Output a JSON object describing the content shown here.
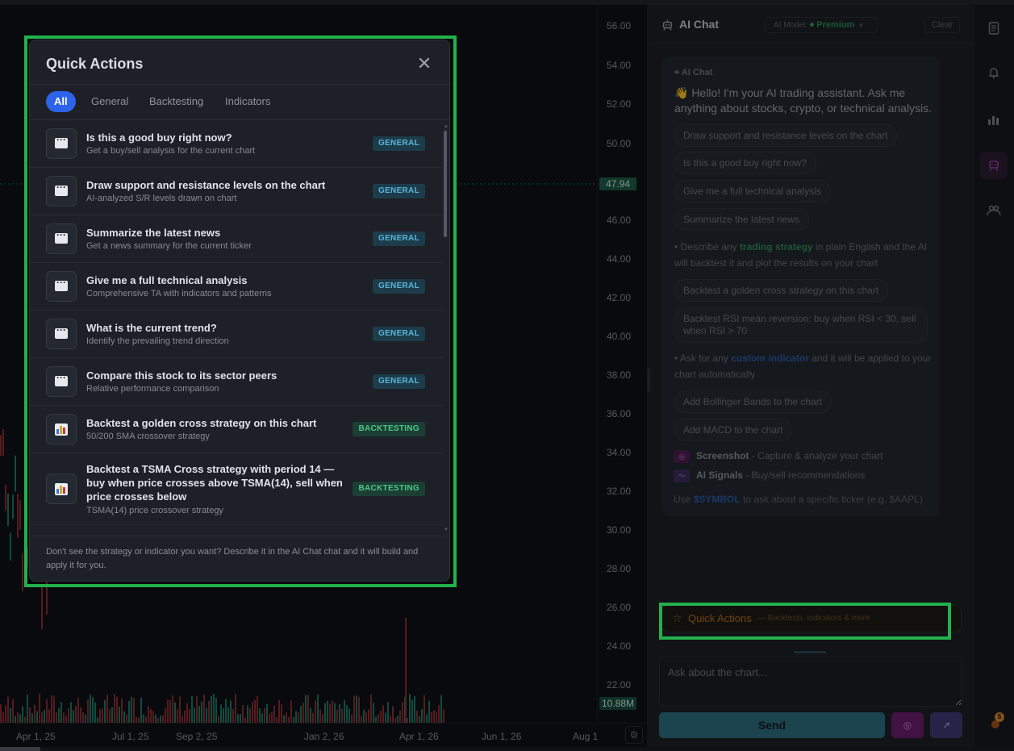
{
  "chart": {
    "price_ticks": [
      "56.00",
      "54.00",
      "52.00",
      "50.00",
      "46.00",
      "44.00",
      "42.00",
      "40.00",
      "38.00",
      "36.00",
      "34.00",
      "32.00",
      "30.00",
      "28.00",
      "26.00",
      "24.00",
      "22.00"
    ],
    "last_price": "47.94",
    "volume_tag": "10.88M",
    "time_ticks": [
      "Apr 1, 25",
      "Jul 1, 25",
      "Sep 2, 25",
      "Jan 2, 26",
      "Apr 1, 26",
      "Jun 1, 26",
      "Aug 1"
    ],
    "gear_icon": "gear-icon",
    "colors": {
      "up": "#26a69a",
      "down": "#ef5350",
      "last_price_tag": "#1d5c44"
    }
  },
  "chat": {
    "title": "AI Chat",
    "robot_icon": "robot-icon",
    "model_label": "AI Model:",
    "model_value": "Premium",
    "clear_label": "Clear",
    "message": {
      "from": "AI Chat",
      "greeting": "👋 Hello! I'm your AI trading assistant. Ask me anything about stocks, crypto, or technical analysis.",
      "chips_1": [
        "Draw support and resistance levels on the chart",
        "Is this a good buy right now?",
        "Give me a full technical analysis",
        "Summarize the latest news"
      ],
      "strategy_pre": "• Describe any ",
      "strategy_hl": "trading strategy",
      "strategy_post": " in plain English and the AI will backtest it and plot the results on your chart",
      "chips_2": [
        "Backtest a golden cross strategy on this chart",
        "Backtest RSI mean reversion: buy when RSI < 30, sell when RSI > 70"
      ],
      "indicator_pre": "• Ask for any ",
      "indicator_hl": "custom indicator",
      "indicator_post": " and it will be applied to your chart automatically",
      "chips_3": [
        "Add Bollinger Bands to the chart",
        "Add MACD to the chart"
      ],
      "feature_screenshot_title": "Screenshot",
      "feature_screenshot_desc": " - Capture & analyze your chart",
      "feature_signals_title": "AI Signals",
      "feature_signals_desc": " - Buy/sell recommendations",
      "hint_pre": "Use ",
      "hint_symbol": "$SYMBOL",
      "hint_post": " to ask about a specific ticker (e.g. $AAPL)"
    },
    "quick_actions_label": "Quick Actions",
    "quick_actions_sub": "— Backtests, indicators & more",
    "input_placeholder": "Ask about the chart...",
    "send_label": "Send",
    "colors": {
      "send": "#2d6e80",
      "screenshot": "#6a1e6e",
      "signals": "#3d3a74",
      "quick_actions_text": "#b36c19"
    }
  },
  "rail": {
    "icons": [
      "document-icon",
      "bell-icon",
      "bar-chart-icon",
      "robot-icon",
      "users-icon"
    ],
    "active": "robot-icon",
    "notification_count": "5"
  },
  "modal": {
    "title": "Quick Actions",
    "close_icon": "close-icon",
    "tabs": [
      "All",
      "General",
      "Backtesting",
      "Indicators"
    ],
    "active_tab": "All",
    "items": [
      {
        "title": "Is this a good buy right now?",
        "desc": "Get a buy/sell analysis for the current chart",
        "badge": "GENERAL",
        "icon": "chat-bubble-icon"
      },
      {
        "title": "Draw support and resistance levels on the chart",
        "desc": "AI-analyzed S/R levels drawn on chart",
        "badge": "GENERAL",
        "icon": "chat-bubble-icon"
      },
      {
        "title": "Summarize the latest news",
        "desc": "Get a news summary for the current ticker",
        "badge": "GENERAL",
        "icon": "chat-bubble-icon"
      },
      {
        "title": "Give me a full technical analysis",
        "desc": "Comprehensive TA with indicators and patterns",
        "badge": "GENERAL",
        "icon": "chat-bubble-icon"
      },
      {
        "title": "What is the current trend?",
        "desc": "Identify the prevailing trend direction",
        "badge": "GENERAL",
        "icon": "chat-bubble-icon"
      },
      {
        "title": "Compare this stock to its sector peers",
        "desc": "Relative performance comparison",
        "badge": "GENERAL",
        "icon": "chat-bubble-icon"
      },
      {
        "title": "Backtest a golden cross strategy on this chart",
        "desc": "50/200 SMA crossover strategy",
        "badge": "BACKTESTING",
        "icon": "bar-chart-icon"
      },
      {
        "title": "Backtest a TSMA Cross strategy with period 14 — buy when price crosses above TSMA(14), sell when price crosses below",
        "desc": "TSMA(14) price crossover strategy",
        "badge": "BACKTESTING",
        "icon": "bar-chart-icon"
      }
    ],
    "footer": "Don't see the strategy or indicator you want? Describe it in the AI Chat chat and it will build and apply it for you."
  }
}
